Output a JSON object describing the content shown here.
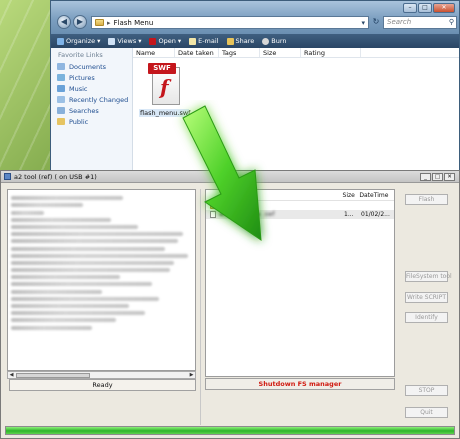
{
  "explorer": {
    "address": "Flash Menu",
    "search_placeholder": "Search",
    "toolbar": [
      "Organize",
      "Views",
      "Open",
      "E-mail",
      "Share",
      "Burn"
    ],
    "columns": [
      "Name",
      "Date taken",
      "Tags",
      "Size",
      "Rating"
    ],
    "favorites_title": "Favorite Links",
    "favorites": [
      "Documents",
      "Pictures",
      "Music",
      "Recently Changed",
      "Searches",
      "Public"
    ],
    "file": {
      "badge": "SWF",
      "name": "flash_menu.swf"
    }
  },
  "a2tool": {
    "title": "a2 tool (ref) ( on USB #1)",
    "status": "Ready",
    "right_columns": [
      "Size",
      "DateTime"
    ],
    "right_file_size": "1...",
    "right_file_date": "01/02/2...",
    "shutdown_label": "Shutdown FS manager",
    "buttons": {
      "flash": "Flash",
      "filesystem": "FileSystem tool",
      "write_script": "Write SCRIPT",
      "identify": "Identify",
      "stop": "STOP",
      "quit": "Quit"
    },
    "progress_percent": 100
  },
  "colors": {
    "arrow_green": "#3fbf1f",
    "progress_green": "#2db52a",
    "shutdown_red": "#d01a10"
  }
}
